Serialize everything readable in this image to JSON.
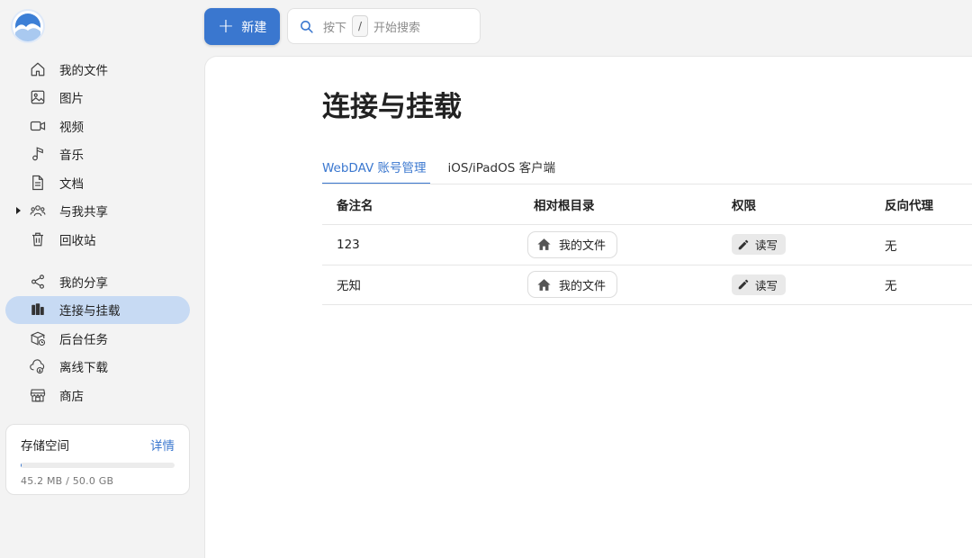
{
  "topbar": {
    "new_label": "新建",
    "search_placeholder": "按下",
    "search_key": "/",
    "search_hint": "开始搜索"
  },
  "sidebar": {
    "items": [
      {
        "label": "我的文件",
        "icon": "home-icon"
      },
      {
        "label": "图片",
        "icon": "image-icon"
      },
      {
        "label": "视频",
        "icon": "video-icon"
      },
      {
        "label": "音乐",
        "icon": "music-icon"
      },
      {
        "label": "文档",
        "icon": "document-icon"
      },
      {
        "label": "与我共享",
        "icon": "people-icon"
      },
      {
        "label": "回收站",
        "icon": "trash-icon"
      },
      {
        "label": "我的分享",
        "icon": "share-icon"
      },
      {
        "label": "连接与挂载",
        "icon": "storage-mount-icon",
        "active": true
      },
      {
        "label": "后台任务",
        "icon": "task-box-icon"
      },
      {
        "label": "离线下载",
        "icon": "cloud-download-icon"
      },
      {
        "label": "商店",
        "icon": "store-icon"
      }
    ],
    "storage": {
      "title": "存储空间",
      "detail_label": "详情",
      "usage_text": "45.2 MB / 50.0 GB",
      "used_fraction": 0.0009
    }
  },
  "main": {
    "title": "连接与挂载",
    "tabs": [
      {
        "label": "WebDAV 账号管理",
        "active": true
      },
      {
        "label": "iOS/iPadOS 客户端",
        "active": false
      }
    ],
    "table": {
      "headers": [
        "备注名",
        "相对根目录",
        "权限",
        "反向代理"
      ],
      "rows": [
        {
          "name": "123",
          "root": "我的文件",
          "perm": "读写",
          "proxy": "无"
        },
        {
          "name": "无知",
          "root": "我的文件",
          "perm": "读写",
          "proxy": "无"
        }
      ]
    }
  },
  "colors": {
    "accent": "#3a77cf",
    "active_nav_bg": "#c7daf3",
    "background": "#f3f3f3"
  }
}
